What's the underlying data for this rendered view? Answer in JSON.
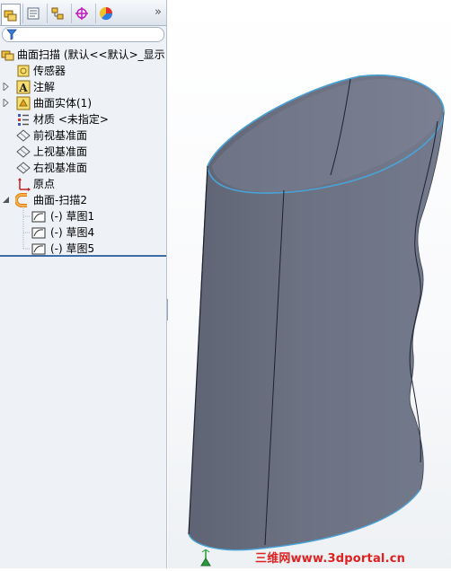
{
  "feature_tree": {
    "root": {
      "label": "曲面扫描 (默认<<默认>_显示"
    },
    "items": [
      {
        "label": "传感器",
        "icon": "sensor-icon"
      },
      {
        "label": "注解",
        "icon": "annotation-icon"
      },
      {
        "label": "曲面实体(1)",
        "icon": "surface-body-icon"
      },
      {
        "label": "材质 <未指定>",
        "icon": "material-icon"
      },
      {
        "label": "前视基准面",
        "icon": "plane-icon"
      },
      {
        "label": "上视基准面",
        "icon": "plane-icon"
      },
      {
        "label": "右视基准面",
        "icon": "plane-icon"
      },
      {
        "label": "原点",
        "icon": "origin-icon"
      },
      {
        "label": "曲面-扫描2",
        "icon": "surface-sweep-icon"
      },
      {
        "label": "(-) 草图1",
        "icon": "sketch-icon"
      },
      {
        "label": "(-) 草图4",
        "icon": "sketch-icon"
      },
      {
        "label": "(-) 草图5",
        "icon": "sketch-icon"
      }
    ]
  },
  "tabs": [
    "feature-manager",
    "property-manager",
    "configuration-manager",
    "dimxpert-manager",
    "display-manager"
  ],
  "watermark": "三维网www.3dportal.cn",
  "colors": {
    "model_body": "#6e7484",
    "edge_highlight": "#4aa3d8",
    "panel_bg": "#eef1f6",
    "panel_accent": "#3a6ea5",
    "watermark": "#e02020"
  }
}
